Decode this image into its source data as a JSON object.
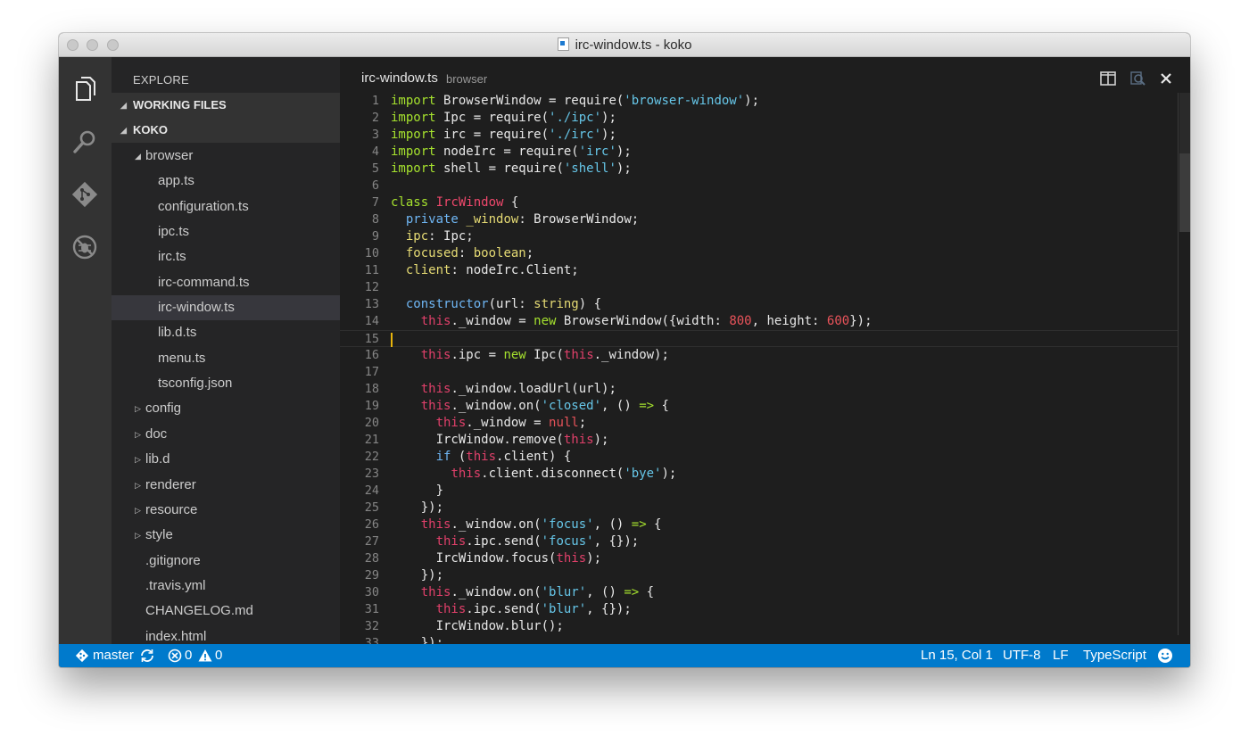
{
  "window": {
    "title": "irc-window.ts - koko"
  },
  "activity_bar": {
    "icons": [
      "explorer-icon",
      "search-icon",
      "git-icon",
      "debug-icon"
    ]
  },
  "sidebar": {
    "header": "EXPLORE",
    "sections": [
      "WORKING FILES",
      "KOKO"
    ],
    "tree": [
      {
        "label": "browser",
        "kind": "folder-open"
      },
      {
        "label": "app.ts",
        "kind": "file"
      },
      {
        "label": "configuration.ts",
        "kind": "file"
      },
      {
        "label": "ipc.ts",
        "kind": "file"
      },
      {
        "label": "irc.ts",
        "kind": "file"
      },
      {
        "label": "irc-command.ts",
        "kind": "file"
      },
      {
        "label": "irc-window.ts",
        "kind": "file",
        "selected": true
      },
      {
        "label": "lib.d.ts",
        "kind": "file"
      },
      {
        "label": "menu.ts",
        "kind": "file"
      },
      {
        "label": "tsconfig.json",
        "kind": "file"
      },
      {
        "label": "config",
        "kind": "folder-closed"
      },
      {
        "label": "doc",
        "kind": "folder-closed"
      },
      {
        "label": "lib.d",
        "kind": "folder-closed"
      },
      {
        "label": "renderer",
        "kind": "folder-closed"
      },
      {
        "label": "resource",
        "kind": "folder-closed"
      },
      {
        "label": "style",
        "kind": "folder-closed"
      },
      {
        "label": ".gitignore",
        "kind": "file"
      },
      {
        "label": ".travis.yml",
        "kind": "file"
      },
      {
        "label": "CHANGELOG.md",
        "kind": "file"
      },
      {
        "label": "index.html",
        "kind": "file"
      }
    ]
  },
  "editor": {
    "tab_file": "irc-window.ts",
    "tab_dir": "browser",
    "actions": [
      "split-editor-icon",
      "open-changes-icon",
      "close-icon"
    ],
    "current_line": 15,
    "lines": [
      [
        [
          "t-import",
          "import"
        ],
        [
          "",
          "  BrowserWindow = require("
        ],
        [
          "t-str",
          "'browser-window'"
        ],
        [
          "",
          ");"
        ]
      ],
      [
        [
          "t-import",
          "import"
        ],
        [
          "",
          "  Ipc = require("
        ],
        [
          "t-str",
          "'./ipc'"
        ],
        [
          "",
          ");"
        ]
      ],
      [
        [
          "t-import",
          "import"
        ],
        [
          "",
          "  irc = require("
        ],
        [
          "t-str",
          "'./irc'"
        ],
        [
          "",
          ");"
        ]
      ],
      [
        [
          "t-import",
          "import"
        ],
        [
          "",
          "  nodeIrc = require("
        ],
        [
          "t-str",
          "'irc'"
        ],
        [
          "",
          ");"
        ]
      ],
      [
        [
          "t-import",
          "import"
        ],
        [
          "",
          "  shell = require("
        ],
        [
          "t-str",
          "'shell'"
        ],
        [
          "",
          ");"
        ]
      ],
      [],
      [
        [
          "t-import",
          "class"
        ],
        [
          "",
          ""
        ],
        [
          "t-cls",
          "IrcWindow"
        ],
        [
          "",
          " {"
        ]
      ],
      [
        [
          "",
          "  "
        ],
        [
          "t-mod",
          "private"
        ],
        [
          "",
          ""
        ],
        [
          "t-prop",
          "_window"
        ],
        [
          "",
          ": BrowserWindow;"
        ]
      ],
      [
        [
          "",
          "  "
        ],
        [
          "t-prop",
          "ipc"
        ],
        [
          "",
          ": Ipc;"
        ]
      ],
      [
        [
          "",
          "  "
        ],
        [
          "t-prop",
          "focused"
        ],
        [
          "",
          ": "
        ],
        [
          "t-type",
          "boolean"
        ],
        [
          "",
          ";"
        ]
      ],
      [
        [
          "",
          "  "
        ],
        [
          "t-prop",
          "client"
        ],
        [
          "",
          ": nodeIrc.Client;"
        ]
      ],
      [],
      [
        [
          "",
          "  "
        ],
        [
          "t-ctor",
          "constructor"
        ],
        [
          "",
          "(url: "
        ],
        [
          "t-type",
          "string"
        ],
        [
          "",
          ") {"
        ]
      ],
      [
        [
          "",
          "    "
        ],
        [
          "t-this",
          "this"
        ],
        [
          "",
          "._window = "
        ],
        [
          "t-new",
          "new"
        ],
        [
          "",
          " BrowserWindow({width: "
        ],
        [
          "t-num",
          "800"
        ],
        [
          "",
          ", height: "
        ],
        [
          "t-num",
          "600"
        ],
        [
          "",
          "});"
        ]
      ],
      [],
      [
        [
          "",
          "    "
        ],
        [
          "t-this",
          "this"
        ],
        [
          "",
          ".ipc = "
        ],
        [
          "t-new",
          "new"
        ],
        [
          "",
          " Ipc("
        ],
        [
          "t-this",
          "this"
        ],
        [
          "",
          "._window);"
        ]
      ],
      [],
      [
        [
          "",
          "    "
        ],
        [
          "t-this",
          "this"
        ],
        [
          "",
          "._window.loadUrl(url);"
        ]
      ],
      [
        [
          "",
          "    "
        ],
        [
          "t-this",
          "this"
        ],
        [
          "",
          "._window.on("
        ],
        [
          "t-str",
          "'closed'"
        ],
        [
          "",
          ", () "
        ],
        [
          "t-arrow",
          "=>"
        ],
        [
          "",
          " {"
        ]
      ],
      [
        [
          "",
          "      "
        ],
        [
          "t-this",
          "this"
        ],
        [
          "",
          "._window = "
        ],
        [
          "t-num",
          "null"
        ],
        [
          "",
          ";"
        ]
      ],
      [
        [
          "",
          "      IrcWindow.remove("
        ],
        [
          "t-this",
          "this"
        ],
        [
          "",
          ");"
        ]
      ],
      [
        [
          "",
          "      "
        ],
        [
          "t-if",
          "if"
        ],
        [
          "",
          " ("
        ],
        [
          "t-this",
          "this"
        ],
        [
          "",
          ".client) {"
        ]
      ],
      [
        [
          "",
          "        "
        ],
        [
          "t-this",
          "this"
        ],
        [
          "",
          ".client.disconnect("
        ],
        [
          "t-str",
          "'bye'"
        ],
        [
          "",
          ");"
        ]
      ],
      [
        [
          "",
          "      }"
        ]
      ],
      [
        [
          "",
          "    });"
        ]
      ],
      [
        [
          "",
          "    "
        ],
        [
          "t-this",
          "this"
        ],
        [
          "",
          "._window.on("
        ],
        [
          "t-str",
          "'focus'"
        ],
        [
          "",
          ", () "
        ],
        [
          "t-arrow",
          "=>"
        ],
        [
          "",
          " {"
        ]
      ],
      [
        [
          "",
          "      "
        ],
        [
          "t-this",
          "this"
        ],
        [
          "",
          ".ipc.send("
        ],
        [
          "t-str",
          "'focus'"
        ],
        [
          "",
          ", {});"
        ]
      ],
      [
        [
          "",
          "      IrcWindow.focus("
        ],
        [
          "t-this",
          "this"
        ],
        [
          "",
          ");"
        ]
      ],
      [
        [
          "",
          "    });"
        ]
      ],
      [
        [
          "",
          "    "
        ],
        [
          "t-this",
          "this"
        ],
        [
          "",
          "._window.on("
        ],
        [
          "t-str",
          "'blur'"
        ],
        [
          "",
          ", () "
        ],
        [
          "t-arrow",
          "=>"
        ],
        [
          "",
          " {"
        ]
      ],
      [
        [
          "",
          "      "
        ],
        [
          "t-this",
          "this"
        ],
        [
          "",
          ".ipc.send("
        ],
        [
          "t-str",
          "'blur'"
        ],
        [
          "",
          ", {});"
        ]
      ],
      [
        [
          "",
          "      IrcWindow.blur();"
        ]
      ],
      [
        [
          "",
          "    });"
        ]
      ]
    ]
  },
  "status_bar": {
    "branch": "master",
    "errors": "0",
    "warnings": "0",
    "position": "Ln 15, Col 1",
    "encoding": "UTF-8",
    "eol": "LF",
    "language": "TypeScript"
  },
  "colors": {
    "status_bar": "#007acc",
    "keyword": "#a6e22e",
    "string": "#66c6e8",
    "this": "#e0406a",
    "type": "#e6db74"
  }
}
